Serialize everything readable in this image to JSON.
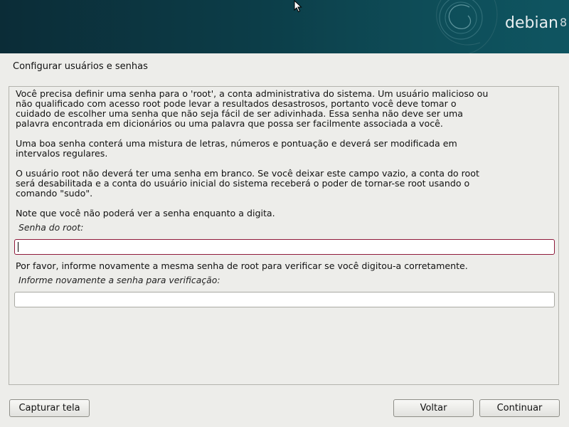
{
  "banner": {
    "logo_text": "debian",
    "logo_version": "8"
  },
  "page": {
    "title": "Configurar usuários e senhas"
  },
  "content": {
    "paragraph1_lines": [
      "Você precisa definir uma senha para o 'root', a conta administrativa do sistema. Um usuário malicioso ou",
      "não qualificado com acesso root pode levar a resultados desastrosos, portanto você deve tomar o",
      "cuidado de escolher uma senha que não seja fácil de ser adivinhada. Essa senha não deve ser uma",
      "palavra encontrada em dicionários ou uma palavra que possa ser facilmente associada a você."
    ],
    "paragraph2_lines": [
      "Uma boa senha conterá uma mistura de letras, números e pontuação e deverá ser modificada em",
      "intervalos regulares."
    ],
    "paragraph3_lines": [
      "O usuário root não deverá ter uma senha em branco. Se você deixar este campo vazio, a conta do root",
      "será desabilitada e a conta do usuário inicial do sistema receberá o poder de tornar-se root usando o",
      "comando \"sudo\"."
    ],
    "paragraph4": "Note que você não poderá ver a senha enquanto a digita.",
    "root_password_label": "Senha do root:",
    "root_password_value": "",
    "verify_prompt": "Por favor, informe novamente a mesma senha de root para verificar se você digitou-a corretamente.",
    "verify_label": "Informe novamente a senha para verificação:",
    "verify_password_value": ""
  },
  "buttons": {
    "screenshot": "Capturar tela",
    "back": "Voltar",
    "continue": "Continuar"
  }
}
